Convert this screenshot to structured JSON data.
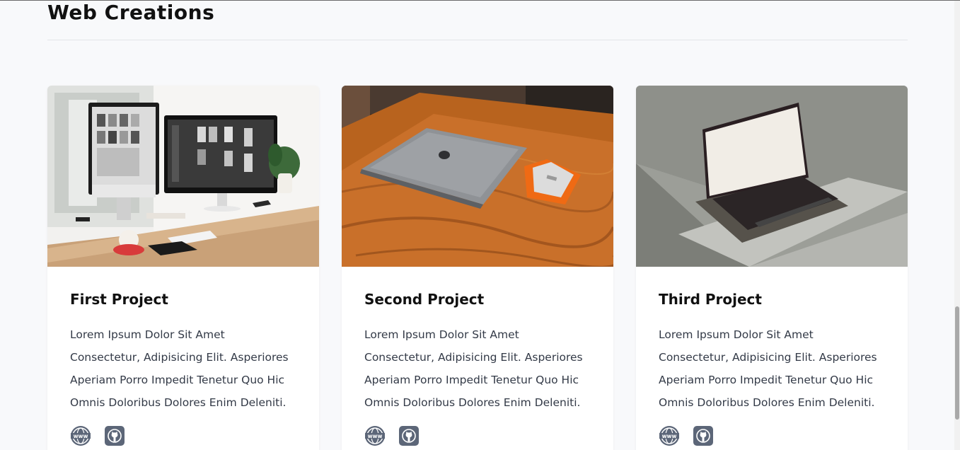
{
  "section": {
    "title": "Web Creations"
  },
  "projects": [
    {
      "title": "First Project",
      "description": "Lorem Ipsum Dolor Sit Amet Consectetur, Adipisicing Elit. Asperiores Aperiam Porro Impedit Tenetur Quo Hic Omnis Doloribus Dolores Enim Deleniti.",
      "image": "desk-with-imac-monitors",
      "links": {
        "website_icon": "www-globe-icon",
        "github_icon": "github-icon"
      }
    },
    {
      "title": "Second Project",
      "description": "Lorem Ipsum Dolor Sit Amet Consectetur, Adipisicing Elit. Asperiores Aperiam Porro Impedit Tenetur Quo Hic Omnis Doloribus Dolores Enim Deleniti.",
      "image": "laptop-on-wooden-table",
      "links": {
        "website_icon": "www-globe-icon",
        "github_icon": "github-icon"
      }
    },
    {
      "title": "Third Project",
      "description": "Lorem Ipsum Dolor Sit Amet Consectetur, Adipisicing Elit. Asperiores Aperiam Porro Impedit Tenetur Quo Hic Omnis Doloribus Dolores Enim Deleniti.",
      "image": "open-laptop-on-grey-block",
      "links": {
        "website_icon": "www-globe-icon",
        "github_icon": "github-icon"
      }
    }
  ],
  "colors": {
    "background": "#f8f9fb",
    "card": "#ffffff",
    "text": "#111111",
    "body_text": "#333a47",
    "icon": "#5c6678"
  }
}
